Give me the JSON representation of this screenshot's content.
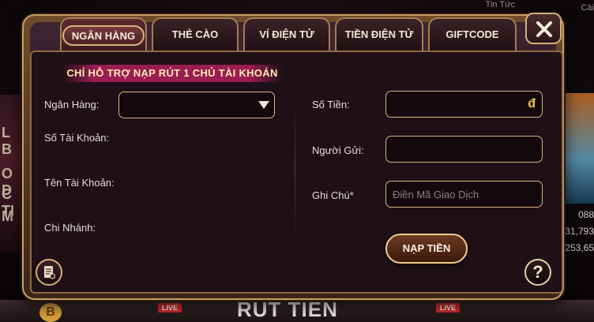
{
  "background": {
    "top_right_label": "Tin Tức",
    "top_right_label_2": "Cài",
    "left_letters": [
      "L B",
      "O D",
      "C TI",
      "M"
    ],
    "right_numbers": [
      "088",
      "31,793",
      "253,65"
    ],
    "bottom_banner": "RÚT TIỀN",
    "live_badge": "LIVE",
    "coin_symbol": "B"
  },
  "tabs": [
    {
      "label": "NGÂN HÀNG",
      "active": true
    },
    {
      "label": "THẺ CÀO",
      "active": false
    },
    {
      "label": "VÍ ĐIỆN TỬ",
      "active": false
    },
    {
      "label": "TIỀN ĐIỆN TỬ",
      "active": false
    },
    {
      "label": "GIFTCODE",
      "active": false
    }
  ],
  "notice": "CHỈ HỖ TRỢ NẠP RÚT 1 CHỦ TÀI KHOẢN",
  "left_form": {
    "bank_label": "Ngân Hàng:",
    "bank_value": "",
    "account_number_label": "Số Tài Khoản:",
    "account_name_label": "Tên Tài Khoản:",
    "branch_label": "Chi Nhánh:"
  },
  "right_form": {
    "amount_label": "Số Tiền:",
    "amount_value": "",
    "currency_symbol": "đ",
    "sender_label": "Người Gửi:",
    "sender_value": "",
    "note_label": "Ghi Chú*",
    "note_placeholder": "Điền Mã Giao Dịch"
  },
  "deposit_button": "NẠP TIỀN",
  "help_glyph": "?",
  "icons": {
    "close": "close-icon",
    "history": "history-icon",
    "dropdown": "chevron-down-icon",
    "help": "help-icon"
  },
  "colors": {
    "frame_gold": "#c9a063",
    "notice_bg": "#ff2882",
    "notice_text": "#ffe9b3",
    "currency": "#f1c84b"
  }
}
